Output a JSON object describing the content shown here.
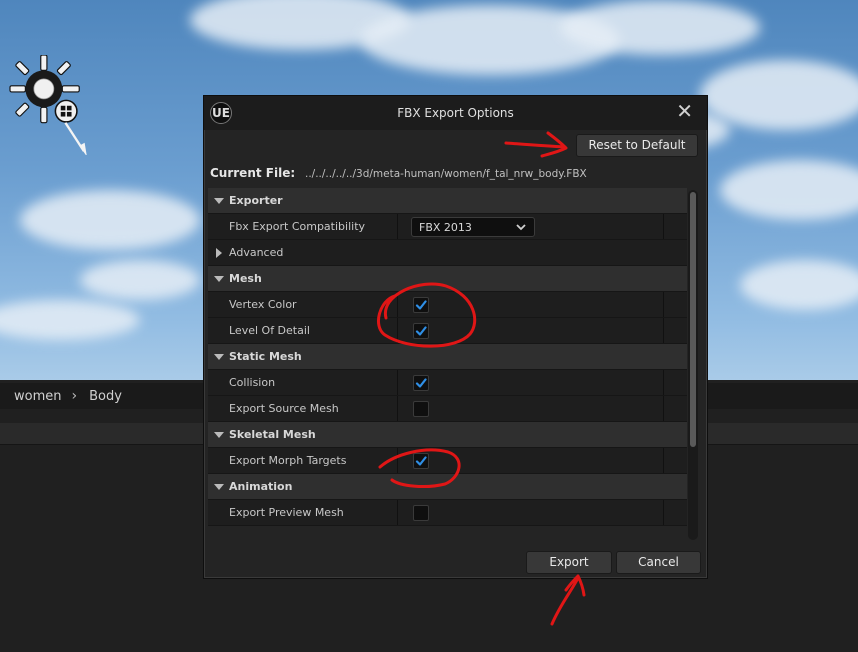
{
  "viewport": {
    "breadcrumb": [
      "women",
      "Body"
    ]
  },
  "dialog": {
    "title": "FBX Export Options",
    "logo": "UE",
    "close_glyph": "✕",
    "reset_label": "Reset to Default",
    "current_file_label": "Current File:",
    "current_file_value": "../../../../../3d/meta-human/women/f_tal_nrw_body.FBX",
    "rows": [
      {
        "type": "category",
        "label": "Exporter",
        "expanded": true
      },
      {
        "type": "combo",
        "label": "Fbx Export Compatibility",
        "value": "FBX 2013"
      },
      {
        "type": "category_sub",
        "label": "Advanced",
        "expanded": false
      },
      {
        "type": "category",
        "label": "Mesh",
        "expanded": true
      },
      {
        "type": "check",
        "label": "Vertex Color",
        "checked": true
      },
      {
        "type": "check",
        "label": "Level Of Detail",
        "checked": true
      },
      {
        "type": "category",
        "label": "Static Mesh",
        "expanded": true
      },
      {
        "type": "check",
        "label": "Collision",
        "checked": true
      },
      {
        "type": "check",
        "label": "Export Source Mesh",
        "checked": false
      },
      {
        "type": "category",
        "label": "Skeletal Mesh",
        "expanded": true
      },
      {
        "type": "check",
        "label": "Export Morph Targets",
        "checked": true
      },
      {
        "type": "category",
        "label": "Animation",
        "expanded": true
      },
      {
        "type": "check",
        "label": "Export Preview Mesh",
        "checked": false
      }
    ],
    "export_label": "Export",
    "cancel_label": "Cancel"
  },
  "colors": {
    "accent_check": "#2f8fe6",
    "annotation_red": "#e01616",
    "dialog_bg": "#242424",
    "category_bg": "#2f2f2f"
  },
  "icons": [
    "unreal-logo-icon",
    "close-icon",
    "chevron-down-icon",
    "checkmark-icon",
    "expand-arrow-icon",
    "collapse-arrow-icon",
    "sun-light-icon"
  ]
}
